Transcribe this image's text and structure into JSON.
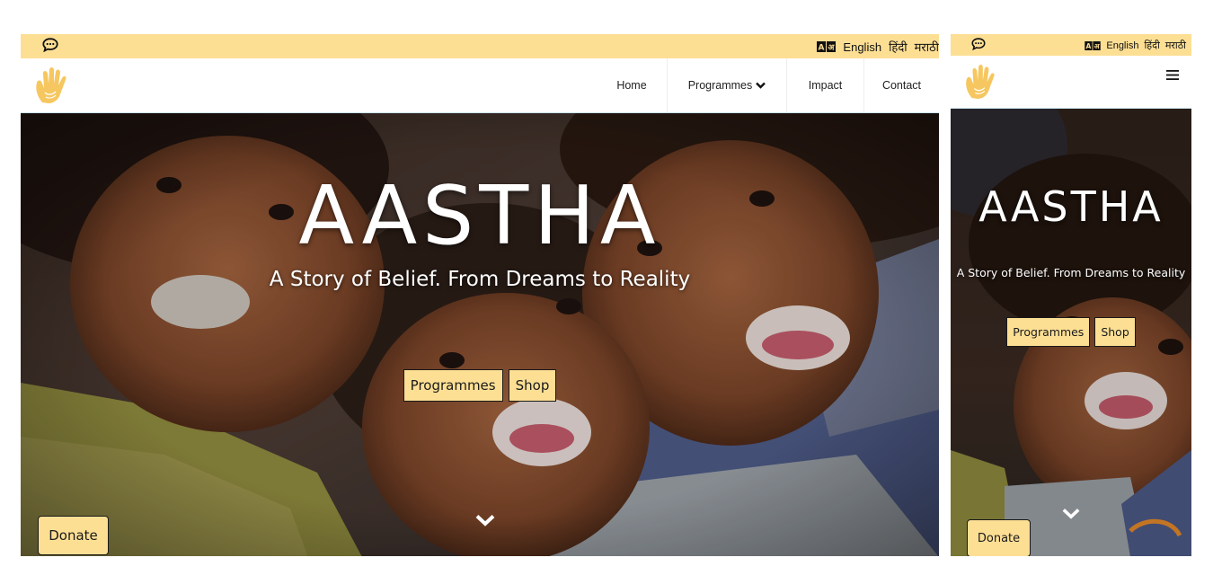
{
  "desktop": {
    "topbar": {
      "icons": {
        "chat": "chat-bubble-icon",
        "translate": "translate-icon"
      },
      "languages": [
        "English",
        "हिंदी",
        "मराठी"
      ]
    },
    "logo": {
      "icon": "raised-hand-logo"
    },
    "nav": {
      "items": [
        {
          "label": "Home"
        },
        {
          "label": "Programmes",
          "icon": "chevron-down-icon"
        },
        {
          "label": "Impact"
        },
        {
          "label": "Contact"
        }
      ]
    },
    "hero": {
      "title": "AASTHA",
      "subtitle": "A Story of Belief. From Dreams to Reality",
      "buttons": [
        "Programmes",
        "Shop"
      ],
      "scroll_icon": "chevron-down-icon"
    },
    "donate_label": "Donate"
  },
  "mobile": {
    "topbar": {
      "icons": {
        "chat": "chat-bubble-icon",
        "translate": "translate-icon"
      },
      "languages": [
        "English",
        "हिंदी",
        "मराठी"
      ]
    },
    "logo": {
      "icon": "raised-hand-logo"
    },
    "menu_icon": "hamburger-icon",
    "hero": {
      "title": "AASTHA",
      "subtitle": "A Story of Belief. From Dreams to Reality",
      "buttons": [
        "Programmes",
        "Shop"
      ],
      "scroll_icon": "chevron-down-icon"
    },
    "donate_label": "Donate"
  },
  "colors": {
    "accent": "#fddf94",
    "logo": "#f6c760",
    "button_border": "#1a1a1a",
    "nav_text": "#222222",
    "hero_text": "#ffffff"
  }
}
